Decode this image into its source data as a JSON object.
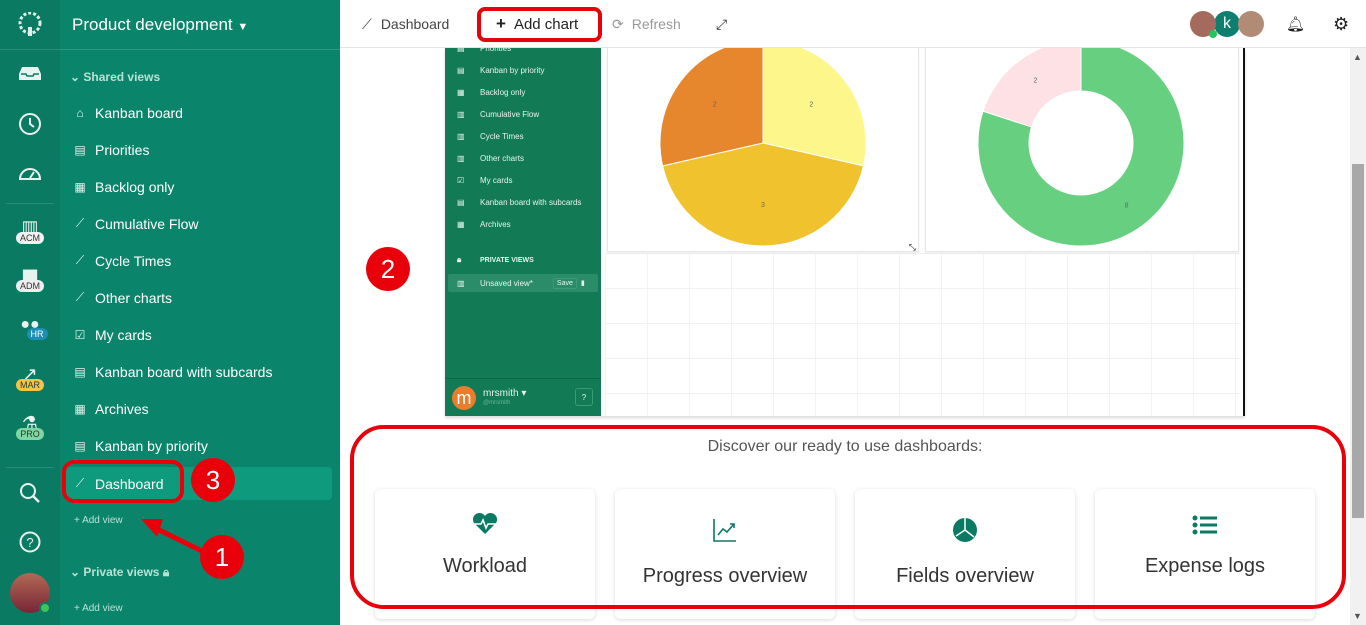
{
  "app": {
    "workspace_title": "Product development",
    "rail": {
      "items": [
        {
          "icon": "inbox-icon"
        },
        {
          "icon": "clock-icon"
        },
        {
          "icon": "dashboard-gauge-icon"
        },
        {
          "icon": "building-icon",
          "badge": "ACM",
          "badge_color": "#f1f1f1"
        },
        {
          "icon": "briefcase-icon",
          "badge": "ADM",
          "badge_color": "#eeeeee"
        },
        {
          "icon": "people-icon",
          "badge": "HR",
          "badge_color": "#1a8fb3"
        },
        {
          "icon": "chart-icon",
          "badge": "MAR",
          "badge_color": "#f4c542"
        },
        {
          "icon": "flask-icon",
          "badge": "PRO",
          "badge_color": "#7ed7a2"
        }
      ],
      "bottom": [
        {
          "icon": "search-icon"
        },
        {
          "icon": "help-icon"
        },
        {
          "icon": "user-avatar"
        }
      ]
    }
  },
  "sidebar": {
    "shared_views_label": "Shared views",
    "items": [
      {
        "label": "Kanban board",
        "icon": "home-icon"
      },
      {
        "label": "Priorities",
        "icon": "board-icon"
      },
      {
        "label": "Backlog only",
        "icon": "table-icon"
      },
      {
        "label": "Cumulative Flow",
        "icon": "line-chart-icon"
      },
      {
        "label": "Cycle Times",
        "icon": "line-chart-icon"
      },
      {
        "label": "Other charts",
        "icon": "line-chart-icon"
      },
      {
        "label": "My cards",
        "icon": "checkbox-icon"
      },
      {
        "label": "Kanban board with subcards",
        "icon": "board-icon"
      },
      {
        "label": "Archives",
        "icon": "table-icon"
      },
      {
        "label": "Kanban by priority",
        "icon": "board-icon"
      },
      {
        "label": "Dashboard",
        "icon": "line-chart-icon",
        "active": true
      }
    ],
    "add_view_label": "Add view",
    "private_views_label": "Private views",
    "private_add_view_label": "Add view"
  },
  "toolbar": {
    "dashboard_label": "Dashboard",
    "add_chart_label": "Add chart",
    "refresh_label": "Refresh",
    "avatar_k_letter": "k"
  },
  "embedded_screenshot": {
    "items": [
      "Priorities",
      "Kanban by priority",
      "Backlog only",
      "Cumulative Flow",
      "Cycle Times",
      "Other charts",
      "My cards",
      "Kanban board with subcards",
      "Archives"
    ],
    "private_views_label": "PRIVATE VIEWS",
    "unsaved_view_label": "Unsaved view*",
    "save_label": "Save",
    "user_name": "mrsmith",
    "user_handle": "@mrsmith",
    "user_initial": "m"
  },
  "chart_data": [
    {
      "type": "pie",
      "values": [
        2,
        3,
        2
      ],
      "labels": [
        "2",
        "3",
        "2"
      ],
      "colors": [
        "#fdf68a",
        "#efc22e",
        "#e6862d"
      ],
      "title": ""
    },
    {
      "type": "pie",
      "donut": true,
      "values": [
        8,
        2
      ],
      "labels": [
        "8",
        "2"
      ],
      "colors": [
        "#66cf80",
        "#fde1e5"
      ],
      "title": ""
    }
  ],
  "discover": {
    "heading": "Discover our ready to use dashboards:",
    "templates": [
      {
        "label": "Workload",
        "icon": "heartbeat-icon"
      },
      {
        "label": "Progress overview",
        "icon": "line-chart-icon"
      },
      {
        "label": "Fields overview",
        "icon": "pie-chart-icon"
      },
      {
        "label": "Expense logs",
        "icon": "list-icon"
      }
    ]
  },
  "annotations": {
    "m1": "1",
    "m2": "2",
    "m3": "3"
  },
  "colors": {
    "brand": "#0a856b",
    "accent": "#0b7a63",
    "annotation": "#e8000b"
  }
}
